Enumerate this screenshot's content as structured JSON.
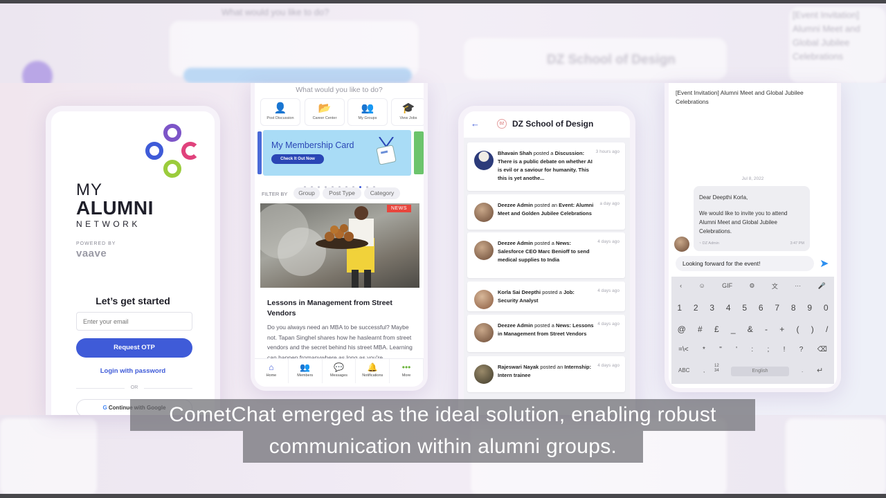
{
  "colors": {
    "primary": "#3f5bd8",
    "news": "#e8453c",
    "send": "#2d8ff0"
  },
  "background": {
    "top_label": "What would you like to do?",
    "top_school": "DZ School of Design",
    "top_invite": "[Event Invitation] Alumni Meet and Global Jubilee Celebrations"
  },
  "login": {
    "logo_line1": "MY",
    "logo_line2": "ALUMNI",
    "logo_line3": "NETWORK",
    "powered_by": "POWERED BY",
    "brand": "vaave",
    "heading": "Let’s get started",
    "email_placeholder": "Enter your email",
    "otp_button": "Request OTP",
    "password_link": "Login with password",
    "or": "OR",
    "google_button": "Continue with Google"
  },
  "home": {
    "question": "What would you like to do?",
    "actions": [
      {
        "label": "Post Discussion",
        "icon": "discussion-icon"
      },
      {
        "label": "Career Center",
        "icon": "career-icon"
      },
      {
        "label": "My Groups",
        "icon": "groups-icon"
      },
      {
        "label": "View Jobs",
        "icon": "jobs-icon"
      }
    ],
    "banner_title": "My Membership Card",
    "banner_button": "Check It Out Now",
    "filter_label": "FILTER BY",
    "filters": [
      "Group",
      "Post Type",
      "Category"
    ],
    "news_badge": "NEWS",
    "article_title": "Lessons in Management from Street Vendors",
    "article_body": "Do you always need an MBA to be successful? Maybe not. Tapan Singhel shares how he haslearnt from street vendors and the secret behind his street MBA. Learning can happen fromanywhere as long as you're",
    "nav": [
      "Home",
      "Members",
      "Messages",
      "Notifications",
      "More"
    ]
  },
  "feed": {
    "school_name": "DZ School of Design",
    "school_logo": "DZ",
    "posts": [
      {
        "name": "Bhavain Shah",
        "action": "posted a",
        "text": "Discussion: There is a public debate on whether AI is evil or a saviour for humanity. This this is yet anothe...",
        "time": "3 hours ago"
      },
      {
        "name": "Deezee Admin",
        "action": "posted an",
        "text": "Event: Alumni Meet and Golden Jubilee Celebrations",
        "time": "a day ago"
      },
      {
        "name": "Deezee Admin",
        "action": "posted a",
        "text": "News: Salesforce CEO Marc Benioff to send medical supplies to India",
        "time": "4 days ago"
      },
      {
        "name": "Korla Sai Deepthi",
        "action": "posted a",
        "text": "Job: Security Analyst",
        "time": "4 days ago"
      },
      {
        "name": "Deezee Admin",
        "action": "posted a",
        "text": "News: Lessons in Management from Street Vendors",
        "time": "4 days ago"
      },
      {
        "name": "Rajeswari Nayak",
        "action": "posted an",
        "text": "Internship: Intern trainee",
        "time": "4 days ago"
      }
    ]
  },
  "chat": {
    "invite_subject": "[Event Invitation] Alumni Meet and Global Jubilee Celebrations",
    "date": "Jul 8, 2022",
    "greeting": "Dear Deepthi Korla,",
    "message": "We would like to invite you to attend Alumni Meet and Global Jubilee Celebrations.",
    "sender": "~ DZ Admin",
    "msg_time": "3:47 PM",
    "input_value": "Looking forward for the event!",
    "keyboard_top": [
      "‹",
      "☺",
      "GIF",
      "⚙",
      "文",
      "···",
      "🎤"
    ],
    "row_numbers": [
      "1",
      "2",
      "3",
      "4",
      "5",
      "6",
      "7",
      "8",
      "9",
      "0"
    ],
    "row_symbols1": [
      "@",
      "#",
      "£",
      "_",
      "&",
      "-",
      "+",
      "(",
      ")",
      "/"
    ],
    "row_symbols2": [
      "=\\<",
      "*",
      "\"",
      "'",
      ":",
      ";",
      "!",
      "?",
      "⌫"
    ],
    "key_abc": "ABC",
    "key_comma": ",",
    "key_1234": "12\n34",
    "space_label": "English",
    "key_dot": ".",
    "key_enter": "↵"
  },
  "caption": {
    "line1": "CometChat emerged as the ideal solution, enabling robust",
    "line2": "communication within alumni groups."
  }
}
